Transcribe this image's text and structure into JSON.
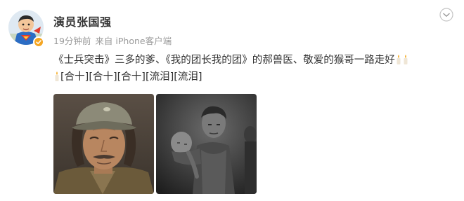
{
  "user": {
    "name": "演员张国强",
    "avatar_icon": "superman-cartoon-avatar",
    "verified_icon": "verified-badge-icon"
  },
  "meta": {
    "time": "19分钟前",
    "source": "来自 iPhone客户端"
  },
  "post": {
    "segment1": "《士兵突击》三多的爹、《我的团长我的团》的郝兽医、敬爱的猴哥一路走好",
    "segment2": "[合十][合十][合十][流泪][流泪]"
  },
  "images": [
    {
      "icon": "portrait-photo-elderly-man-with-cap"
    },
    {
      "icon": "film-still-man-carrying-child"
    }
  ],
  "colors": {
    "text": "#333333",
    "meta": "#9a9a9a",
    "badge": "#f5a623"
  }
}
